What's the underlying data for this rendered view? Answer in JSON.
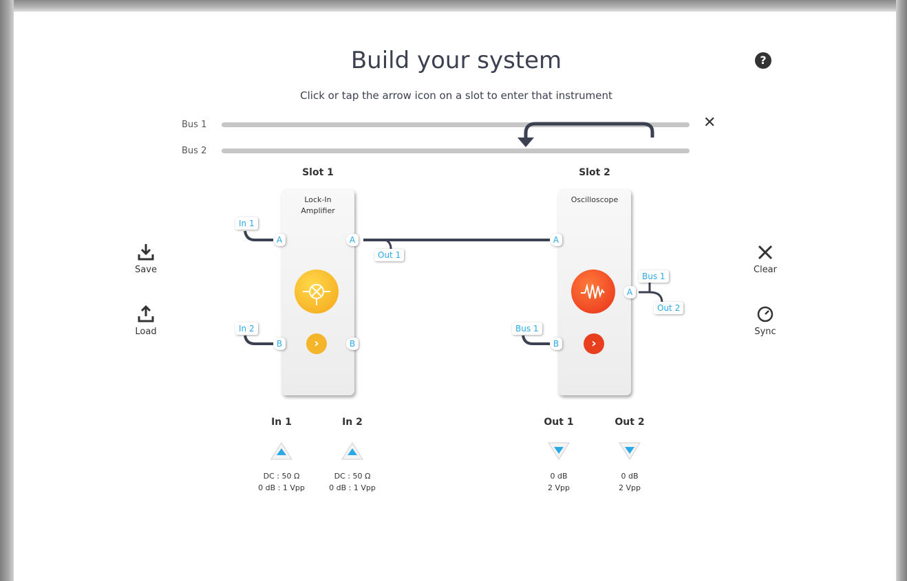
{
  "header": {
    "title": "Build your system",
    "subtitle": "Click or tap the arrow icon on a slot to enter that instrument",
    "help_label": "?"
  },
  "buses": {
    "bus1_label": "Bus 1",
    "bus2_label": "Bus 2",
    "close_glyph": "✕"
  },
  "slots": [
    {
      "title": "Slot 1",
      "instrument_line1": "Lock-In",
      "instrument_line2": "Amplifier",
      "input_a_source": "In 1",
      "input_b_source": "In 2",
      "port_a": "A",
      "port_b": "B",
      "output_a_dest": "Out 1",
      "icon": "lock-in-amplifier-icon",
      "color": "#f5b52a"
    },
    {
      "title": "Slot 2",
      "instrument_line1": "Oscilloscope",
      "input_a_source": "",
      "input_b_source": "Bus 1",
      "port_a": "A",
      "port_b": "B",
      "output_a_dest1": "Bus 1",
      "output_a_dest2": "Out 2",
      "icon": "oscilloscope-icon",
      "color": "#f04a22"
    }
  ],
  "side_actions": {
    "save": "Save",
    "load": "Load",
    "clear": "Clear",
    "sync": "Sync"
  },
  "analog_io": [
    {
      "name": "In 1",
      "direction": "up",
      "line1": "DC : 50 Ω",
      "line2": "0 dB : 1 Vpp"
    },
    {
      "name": "In 2",
      "direction": "up",
      "line1": "DC : 50 Ω",
      "line2": "0 dB : 1 Vpp"
    },
    {
      "name": "Out 1",
      "direction": "down",
      "line1": "0 dB",
      "line2": "2 Vpp"
    },
    {
      "name": "Out 2",
      "direction": "down",
      "line1": "0 dB",
      "line2": "2 Vpp"
    }
  ],
  "colors": {
    "accent_blue": "#2ba9e6",
    "wire": "#3b4150",
    "bus": "#c6c6c6"
  }
}
